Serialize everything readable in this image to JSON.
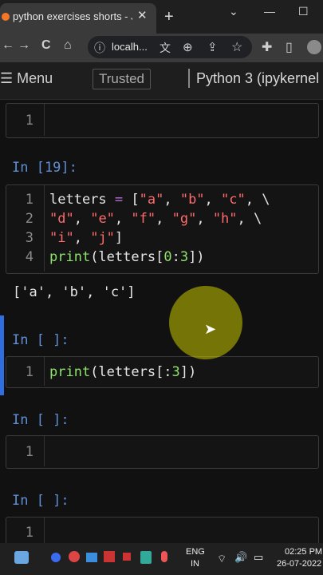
{
  "browser": {
    "tab_title": "python exercises shorts - Jupy",
    "tab_close": "✕",
    "new_tab": "+",
    "win_min": "⌄",
    "win_minimize": "—",
    "win_max": "☐",
    "address": "localh...",
    "back_icon": "←",
    "forward_icon": "→",
    "reload_icon": "C",
    "home_icon": "⌂",
    "info_icon": "ⓘ",
    "translate_icon": "文",
    "zoom_icon": "⊕",
    "share_icon": "⇪",
    "star_icon": "☆",
    "extensions_icon": "✚",
    "sidepanel_icon": "▯"
  },
  "jupyter": {
    "menu_label": "Menu",
    "trusted_label": "Trusted",
    "kernel_label": "Python 3 (ipykernel"
  },
  "cells": {
    "cell0_line": "1",
    "cell1_prompt": "In [19]:",
    "cell1_lines": [
      "1",
      "2",
      "3",
      "4"
    ],
    "cell1_output": "['a', 'b', 'c']",
    "cell2_prompt": "In [ ]:",
    "cell2_line": "1",
    "cell3_prompt": "In [ ]:",
    "cell3_line": "1",
    "cell4_prompt": "In [ ]:",
    "cell4_line": "1"
  },
  "taskbar": {
    "lang_top": "ENG",
    "lang_bottom": "IN",
    "time": "02:25 PM",
    "date": "26-07-2022"
  },
  "colors": {
    "prompt": "#5f8fd6",
    "keyword_green": "#8fe36b",
    "string_red": "#ff6b6b",
    "active_bar": "#2f6ee0"
  }
}
